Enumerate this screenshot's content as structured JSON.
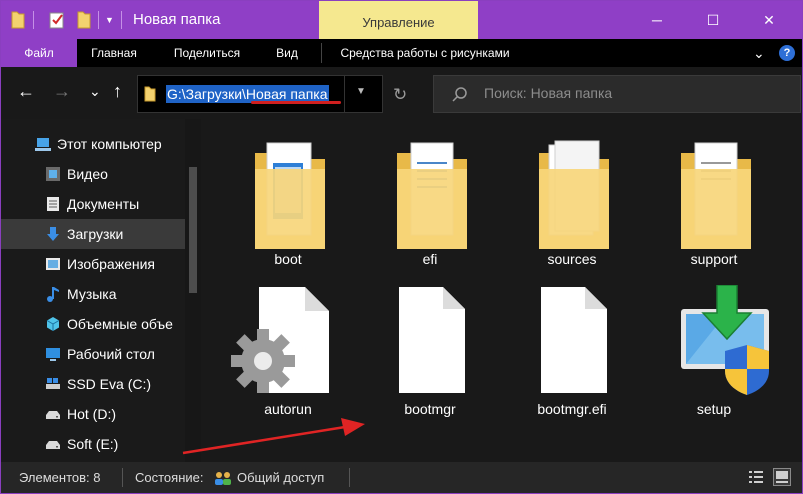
{
  "window": {
    "title": "Новая папка",
    "manage_tab": "Управление",
    "accent": "#8f3fc6",
    "manage_color": "#f5e88f",
    "minimize": "─",
    "maximize": "☐",
    "close": "✕"
  },
  "ribbon": {
    "tabs": [
      "Файл",
      "Главная",
      "Поделиться",
      "Вид",
      "Средства работы с рисунками"
    ],
    "expand": "⌄",
    "help": "?"
  },
  "nav": {
    "back": "←",
    "forward": "→",
    "recent": "⌄",
    "up": "↑",
    "address": "G:\\Загрузки\\Новая папка",
    "refresh": "↻",
    "search_placeholder": "Поиск: Новая папка"
  },
  "sidebar": {
    "items": [
      {
        "label": "Этот компьютер",
        "icon": "computer-icon"
      },
      {
        "label": "Видео",
        "icon": "video-icon"
      },
      {
        "label": "Документы",
        "icon": "documents-icon"
      },
      {
        "label": "Загрузки",
        "icon": "downloads-icon",
        "selected": true
      },
      {
        "label": "Изображения",
        "icon": "pictures-icon"
      },
      {
        "label": "Музыка",
        "icon": "music-icon"
      },
      {
        "label": "Объемные объе",
        "icon": "3d-objects-icon"
      },
      {
        "label": "Рабочий стол",
        "icon": "desktop-icon"
      },
      {
        "label": "SSD Eva (C:)",
        "icon": "drive-c-icon"
      },
      {
        "label": "Hot (D:)",
        "icon": "drive-icon"
      },
      {
        "label": "Soft (E:)",
        "icon": "drive-icon"
      }
    ]
  },
  "files": [
    {
      "name": "boot",
      "type": "folder"
    },
    {
      "name": "efi",
      "type": "folder"
    },
    {
      "name": "sources",
      "type": "folder"
    },
    {
      "name": "support",
      "type": "folder"
    },
    {
      "name": "autorun",
      "type": "settings-file"
    },
    {
      "name": "bootmgr",
      "type": "file"
    },
    {
      "name": "bootmgr.efi",
      "type": "file"
    },
    {
      "name": "setup",
      "type": "installer"
    }
  ],
  "status": {
    "count": "Элементов: 8",
    "state_label": "Состояние:",
    "state_value": "Общий доступ"
  }
}
